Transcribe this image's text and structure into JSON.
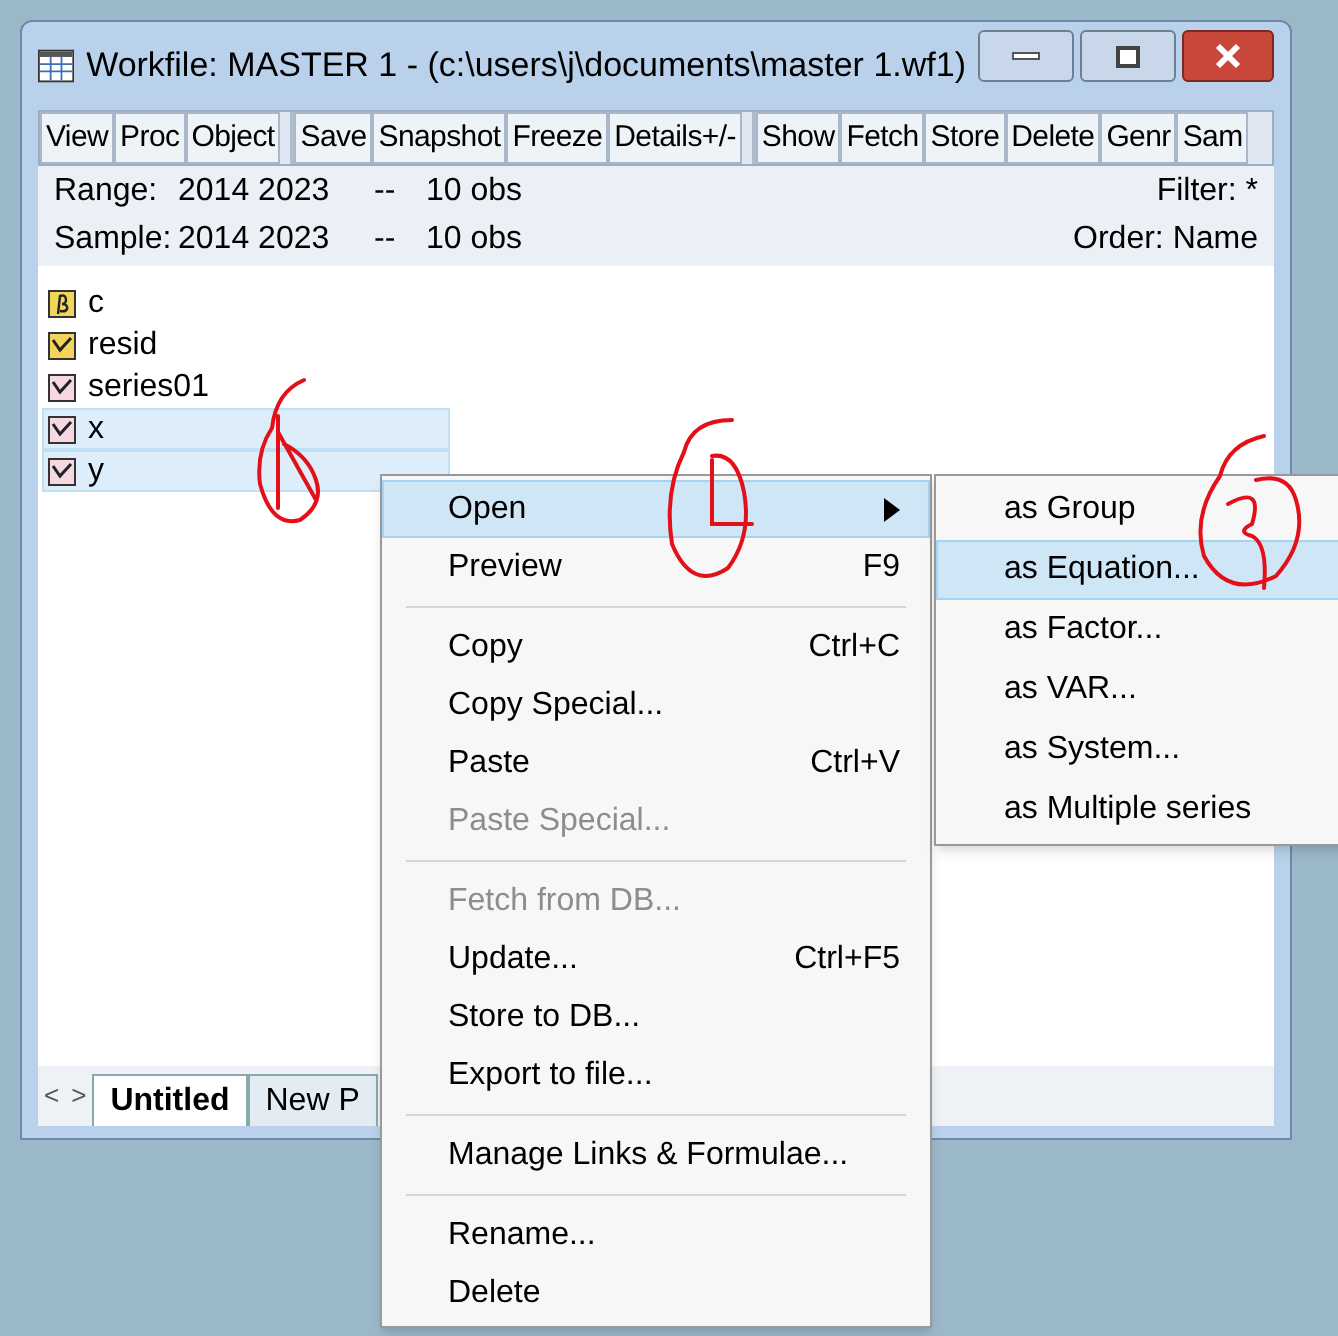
{
  "window": {
    "title": "Workfile: MASTER 1 - (c:\\users\\j\\documents\\master 1.wf1)"
  },
  "toolbar_groups": [
    [
      "View",
      "Proc",
      "Object"
    ],
    [
      "Save",
      "Snapshot",
      "Freeze",
      "Details+/-"
    ],
    [
      "Show",
      "Fetch",
      "Store",
      "Delete",
      "Genr",
      "Sam"
    ]
  ],
  "info": [
    {
      "label": "Range:",
      "value": "2014 2023",
      "dash": "--",
      "obs": "10 obs",
      "right": "Filter: *"
    },
    {
      "label": "Sample:",
      "value": "2014 2023",
      "dash": "--",
      "obs": "10 obs",
      "right": "Order: Name"
    }
  ],
  "objects": [
    {
      "name": "c",
      "kind": "coef",
      "selected": false
    },
    {
      "name": "resid",
      "kind": "resid",
      "selected": false
    },
    {
      "name": "series01",
      "kind": "series",
      "selected": false
    },
    {
      "name": "x",
      "kind": "series",
      "selected": true
    },
    {
      "name": "y",
      "kind": "series",
      "selected": true
    }
  ],
  "tab_nav": [
    "<",
    ">"
  ],
  "tabs": [
    {
      "label": "Untitled",
      "selected": true
    },
    {
      "label": "New P",
      "selected": false
    }
  ],
  "context_menu": [
    {
      "kind": "item",
      "label": "Open",
      "submenu": true,
      "selected": true,
      "disabled": false
    },
    {
      "kind": "item",
      "label": "Preview",
      "shortcut": "F9",
      "selected": false,
      "disabled": false
    },
    {
      "kind": "separator"
    },
    {
      "kind": "item",
      "label": "Copy",
      "shortcut": "Ctrl+C",
      "selected": false,
      "disabled": false
    },
    {
      "kind": "item",
      "label": "Copy Special...",
      "selected": false,
      "disabled": false
    },
    {
      "kind": "item",
      "label": "Paste",
      "shortcut": "Ctrl+V",
      "selected": false,
      "disabled": false
    },
    {
      "kind": "item",
      "label": "Paste Special...",
      "selected": false,
      "disabled": true
    },
    {
      "kind": "separator"
    },
    {
      "kind": "item",
      "label": "Fetch from DB...",
      "selected": false,
      "disabled": true
    },
    {
      "kind": "item",
      "label": "Update...",
      "shortcut": "Ctrl+F5",
      "selected": false,
      "disabled": false
    },
    {
      "kind": "item",
      "label": "Store to DB...",
      "selected": false,
      "disabled": false
    },
    {
      "kind": "item",
      "label": "Export to file...",
      "selected": false,
      "disabled": false
    },
    {
      "kind": "separator"
    },
    {
      "kind": "item",
      "label": "Manage Links & Formulae...",
      "selected": false,
      "disabled": false
    },
    {
      "kind": "separator"
    },
    {
      "kind": "item",
      "label": "Rename...",
      "selected": false,
      "disabled": false
    },
    {
      "kind": "item",
      "label": "Delete",
      "selected": false,
      "disabled": false
    }
  ],
  "submenu": [
    {
      "label": "as Group",
      "selected": false
    },
    {
      "label": "as Equation...",
      "selected": true
    },
    {
      "label": "as Factor...",
      "selected": false
    },
    {
      "label": "as VAR...",
      "selected": false
    },
    {
      "label": "as System...",
      "selected": false
    },
    {
      "label": "as Multiple series",
      "selected": false
    }
  ]
}
